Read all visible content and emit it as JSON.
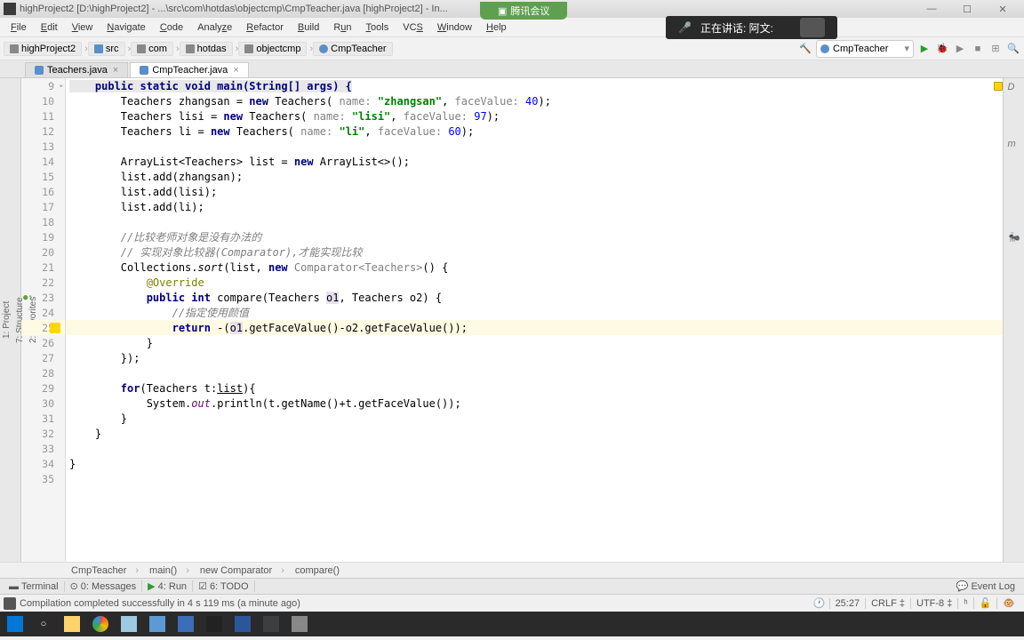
{
  "window": {
    "title": "highProject2 [D:\\highProject2] - ...\\src\\com\\hotdas\\objectcmp\\CmpTeacher.java [highProject2] - In..."
  },
  "top_tab": {
    "label": "腾讯会议"
  },
  "speaking": {
    "label": "正在讲话: 阿文:"
  },
  "menu": {
    "file": "File",
    "edit": "Edit",
    "view": "View",
    "navigate": "Navigate",
    "code": "Code",
    "analyze": "Analyze",
    "refactor": "Refactor",
    "build": "Build",
    "run": "Run",
    "tools": "Tools",
    "vcs": "VCS",
    "window": "Window",
    "help": "Help"
  },
  "breadcrumb": [
    "highProject2",
    "src",
    "com",
    "hotdas",
    "objectcmp",
    "CmpTeacher"
  ],
  "run_config": "CmpTeacher",
  "tabs": [
    {
      "label": "Teachers.java",
      "active": false
    },
    {
      "label": "CmpTeacher.java",
      "active": true
    }
  ],
  "left_tools": {
    "project": "1: Project",
    "structure": "7: Structure",
    "favorites": "2: Favorites"
  },
  "right_tools": {
    "database": "Database",
    "maven": "Maven Projects",
    "ant": "Ant Build"
  },
  "code": {
    "first_line_no": 9,
    "l9": "    public static void main(String[] args) {",
    "l10a": "        Teachers zhangsan = ",
    "l10b": "new",
    "l10c": " Teachers( ",
    "l10p": "name: ",
    "l10s": "\"zhangsan\"",
    "l10d": ", ",
    "l10p2": "faceValue: ",
    "l10n": "40",
    "l10e": ");",
    "l11a": "        Teachers lisi = ",
    "l11b": "new",
    "l11c": " Teachers( ",
    "l11p": "name: ",
    "l11s": "\"lisi\"",
    "l11d": ", ",
    "l11p2": "faceValue: ",
    "l11n": "97",
    "l11e": ");",
    "l12a": "        Teachers li = ",
    "l12b": "new",
    "l12c": " Teachers( ",
    "l12p": "name: ",
    "l12s": "\"li\"",
    "l12d": ", ",
    "l12p2": "faceValue: ",
    "l12n": "60",
    "l12e": ");",
    "l14a": "        ArrayList<Teachers> list = ",
    "l14b": "new",
    "l14c": " ArrayList<>();",
    "l15": "        list.add(zhangsan);",
    "l16": "        list.add(lisi);",
    "l17": "        list.add(li);",
    "l19": "        //比较老师对象是没有办法的",
    "l20a": "        // 实现对象比较器",
    "l20b": "(Comparator)",
    "l20c": ",才能实现比较",
    "l21a": "        Collections.",
    "l21b": "sort",
    "l21c": "(list, ",
    "l21d": "new",
    "l21e": " ",
    "l21f": "Comparator<Teachers>",
    "l21g": "() {",
    "l22": "            @Override",
    "l23a": "            ",
    "l23b": "public int",
    "l23c": " compare(Teachers ",
    "l23d": "o1",
    "l23e": ", Teachers o2) {",
    "l24": "                //指定使用颜值",
    "l25a": "                ",
    "l25b": "return",
    "l25c": " -(",
    "l25d": "o1",
    "l25e": ".getFaceValue()-o2.getFaceValue());",
    "l26": "            }",
    "l27": "        });",
    "l29a": "        ",
    "l29b": "for",
    "l29c": "(Teachers t:",
    "l29d": "list",
    "l29e": "){",
    "l30a": "            System.",
    "l30b": "out",
    "l30c": ".println(t.getName()+t.getFaceValue());",
    "l31": "        }",
    "l32": "    }",
    "l34": "}"
  },
  "nav_bottom": [
    "CmpTeacher",
    "main()",
    "new Comparator",
    "compare()"
  ],
  "tool_panel": {
    "terminal": "Terminal",
    "messages": "0: Messages",
    "run": "4: Run",
    "todo": "6: TODO",
    "event_log": "Event Log"
  },
  "status": {
    "message": "Compilation completed successfully in 4 s 119 ms (a minute ago)",
    "pos": "25:27",
    "crlf": "CRLF",
    "enc": "UTF-8",
    "context": "⎇"
  }
}
